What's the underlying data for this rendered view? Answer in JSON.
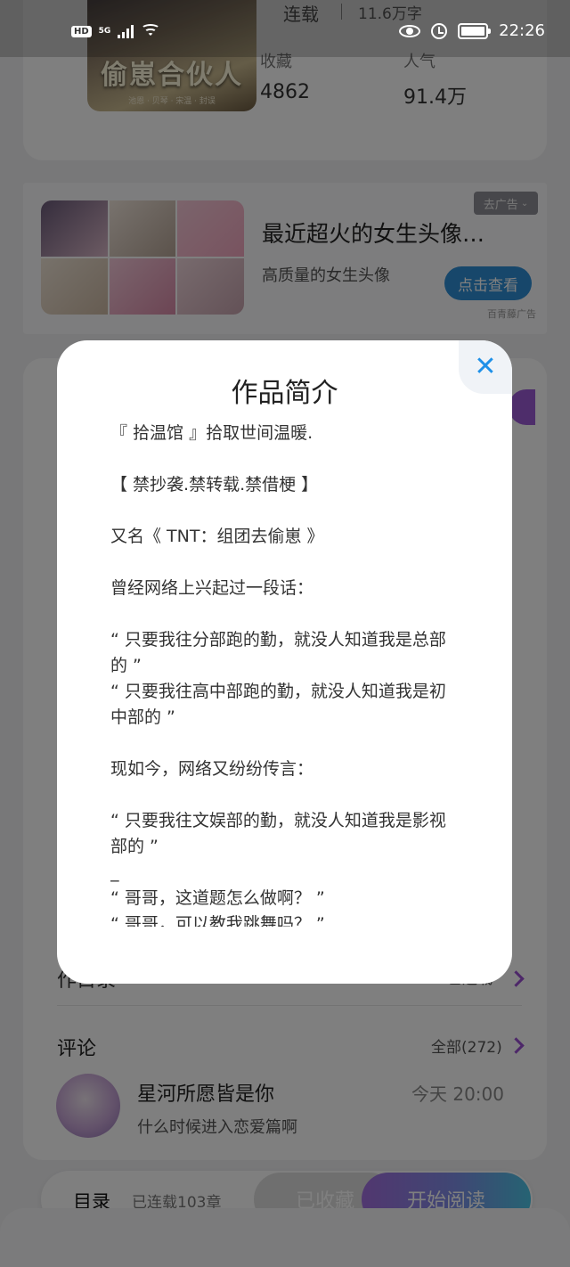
{
  "status_bar": {
    "hd": "HD",
    "network": "5G",
    "time": "22:26"
  },
  "book": {
    "cover_title": "偷崽合伙人",
    "cover_subtitle": "池恩 · 贝琴 · 宋温 · 封误",
    "status": "连载",
    "words": "11.6万字",
    "stats": [
      {
        "label": "收藏",
        "value": "4862"
      },
      {
        "label": "人气",
        "value": "91.4万"
      }
    ]
  },
  "ad": {
    "remove_label": "去广告",
    "title": "最近超火的女生头像…",
    "description": "高质量的女生头像",
    "button": "点击查看",
    "source": "百青藤广告"
  },
  "sections": {
    "catalog_label": "作目录",
    "catalog_status": "已连载"
  },
  "comments": {
    "title": "评论",
    "all_label": "全部(272)",
    "items": [
      {
        "user": "星河所愿皆是你",
        "time": "今天 20:00",
        "text": "什么时候进入恋爱篇啊"
      }
    ]
  },
  "bottom_bar": {
    "toc_label": "目录",
    "toc_count": "已连载103章",
    "collected_label": "已收藏",
    "read_label": "开始阅读"
  },
  "modal": {
    "title": "作品简介",
    "close_icon": "close-icon",
    "paragraphs": [
      "『 拾温馆 』拾取世间温暖.",
      "",
      "【 禁抄袭.禁转载.禁借梗 】",
      "",
      "又名《 TNT：组团去偷崽 》",
      "",
      "曾经网络上兴起过一段话：",
      "",
      "“ 只要我往分部跑的勤，就没人知道我是总部的 ”",
      "“ 只要我往高中部跑的勤，就没人知道我是初中部的 ”",
      "",
      "现如今，网络又纷纷传言：",
      "",
      "“ 只要我往文娱部的勤，就没人知道我是影视部的 ”",
      "_",
      "“ 哥哥，这道题怎么做啊？ ”",
      "“ 哥哥，可以教我跳舞吗？ ”"
    ]
  },
  "colors": {
    "accent_purple": "#9a4fd2",
    "ad_button_blue": "#2f8fd6",
    "close_blue": "#1e90e8"
  }
}
